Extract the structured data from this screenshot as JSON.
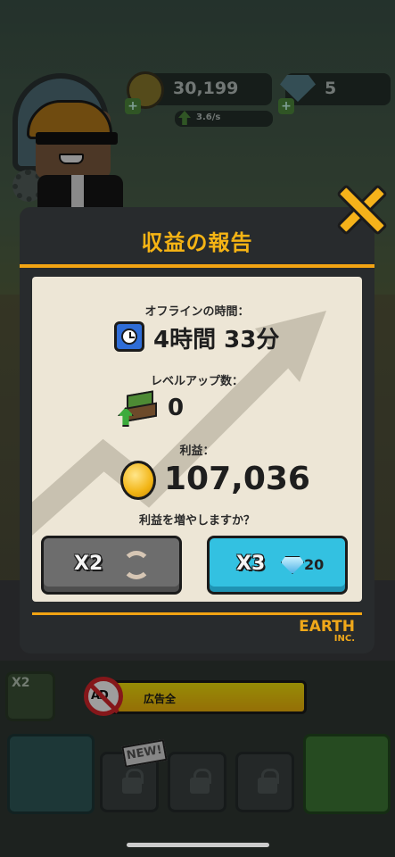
{
  "hud": {
    "coins": "30,199",
    "gems": "5",
    "rate": "3.6/s",
    "plus_label": "+"
  },
  "modal": {
    "title": "収益の報告",
    "offline_time_label": "オフラインの時間：",
    "offline_time_value": "4時間 33分",
    "level_ups_label": "レベルアップ数：",
    "level_ups_value": "0",
    "profit_label": "利益：",
    "profit_value": "107,036",
    "boost_question": "利益を増やしますか？",
    "x2_button_label": "X2",
    "x3_button_label": "X3",
    "x3_gem_cost": "20",
    "brand_line1": "EARTH",
    "brand_line2": "INC."
  },
  "bottom": {
    "x2_badge": "X2",
    "ad_icon_text": "AD",
    "ad_bar_label": "広告全",
    "new_tag": "NEW!"
  },
  "colors": {
    "accent_orange": "#f2a413",
    "title_yellow": "#f6b414",
    "panel_bg": "#ede6d6",
    "x3_button": "#33c1e1",
    "x2_button": "#6d6d6d"
  },
  "icons": [
    "clock-icon",
    "level-up-icon",
    "coin-icon",
    "refresh-icon",
    "gem-icon",
    "close-icon",
    "lock-icon",
    "no-ads-icon"
  ]
}
